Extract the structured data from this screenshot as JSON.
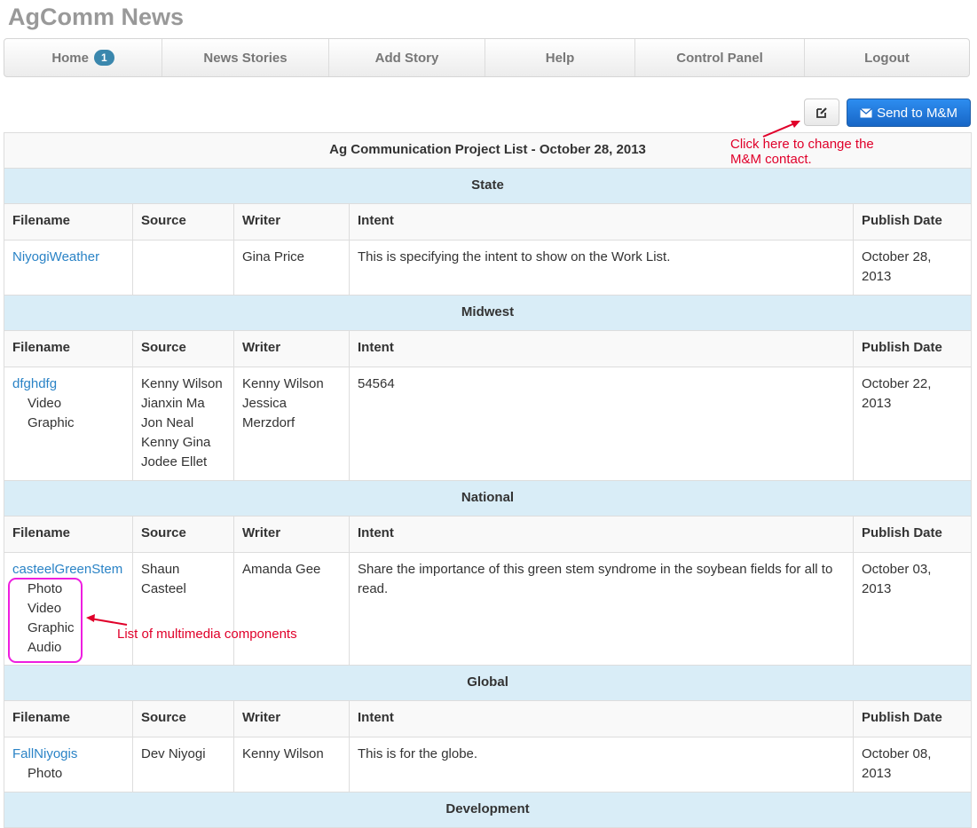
{
  "app": {
    "title": "AgComm News"
  },
  "nav": [
    {
      "label": "Home",
      "badge": "1"
    },
    {
      "label": "News Stories"
    },
    {
      "label": "Add Story"
    },
    {
      "label": "Help"
    },
    {
      "label": "Control Panel"
    },
    {
      "label": "Logout"
    }
  ],
  "actions": {
    "send_label": "Send to M&M",
    "edit_icon": "edit-icon",
    "send_icon": "envelope-icon"
  },
  "table": {
    "title": "Ag Communication Project List - October 28, 2013",
    "columns": [
      "Filename",
      "Source",
      "Writer",
      "Intent",
      "Publish Date"
    ],
    "groups": [
      {
        "region": "State",
        "rows": [
          {
            "filename": "NiyogiWeather",
            "components": [],
            "source": [],
            "writer": [
              "Gina Price"
            ],
            "intent": "This is specifying the intent to show on the Work List.",
            "publish_date": [
              "October 28,",
              "2013"
            ]
          }
        ]
      },
      {
        "region": "Midwest",
        "rows": [
          {
            "filename": "dfghdfg",
            "components": [
              "Video",
              "Graphic"
            ],
            "source": [
              "Kenny Wilson",
              "Jianxin Ma",
              "Jon Neal",
              "Kenny Gina",
              "Jodee Ellet"
            ],
            "writer": [
              "Kenny Wilson",
              "Jessica",
              "Merzdorf"
            ],
            "intent": "54564",
            "publish_date": [
              "October 22,",
              "2013"
            ]
          }
        ]
      },
      {
        "region": "National",
        "rows": [
          {
            "filename": "casteelGreenStem",
            "components": [
              "Photo",
              "Video",
              "Graphic",
              "Audio"
            ],
            "source": [
              "Shaun",
              "Casteel"
            ],
            "writer": [
              "Amanda Gee"
            ],
            "intent": "Share the importance of this green stem syndrome in the soybean fields for all to read.",
            "publish_date": [
              "October 03,",
              "2013"
            ]
          }
        ]
      },
      {
        "region": "Global",
        "rows": [
          {
            "filename": "FallNiyogis",
            "components": [
              "Photo"
            ],
            "source": [
              "Dev Niyogi"
            ],
            "writer": [
              "Kenny Wilson"
            ],
            "intent": "This is for the globe.",
            "publish_date": [
              "October 08,",
              "2013"
            ]
          }
        ]
      },
      {
        "region": "Development",
        "rows": []
      }
    ]
  },
  "annotations": {
    "contact_note_line1": "Click here to change the",
    "contact_note_line2": "M&M contact.",
    "components_note": "List of multimedia components",
    "color": "#e0002a"
  },
  "colors": {
    "region_bg": "#d9edf7",
    "link": "#2a83c6",
    "primary_button": "#1866c6",
    "badge": "#3a87ad",
    "highlight": "#ee1ee0"
  }
}
